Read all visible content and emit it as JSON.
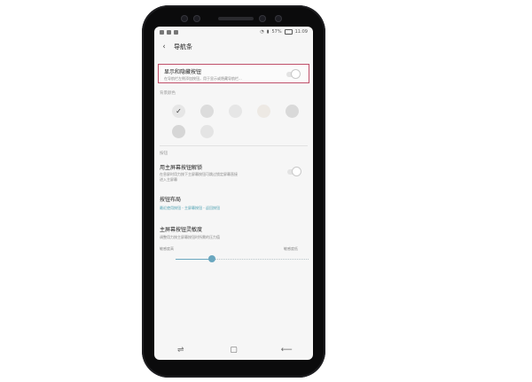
{
  "status": {
    "left_icons": [
      "whatsapp-icon",
      "mail-icon",
      "image-icon"
    ],
    "battery": "57%",
    "time": "11:09"
  },
  "header": {
    "title": "导航条"
  },
  "show_hide_buttons": {
    "title": "显示和隐藏按钮",
    "subtitle": "在导航栏左侧添加按钮，用于显示或隐藏导航栏...",
    "toggle_on": false
  },
  "background_color": {
    "label": "背景颜色",
    "swatches": [
      "#ffffff",
      "#e6e6e6",
      "#dcdcdc",
      "#e6e6e6",
      "#ede9e4",
      "#d9d9d9",
      "#d6d6d6",
      "#e4e4e4"
    ],
    "selected_index": 0
  },
  "buttons_section": {
    "label": "按钮"
  },
  "unlock_with_home": {
    "title": "用主屏幕按钮解锁",
    "subtitle_line1": "在息屏时用力按下主屏幕按钮可跳过锁定屏幕直接",
    "subtitle_line2": "进入主屏幕",
    "toggle_on": false
  },
  "button_layout": {
    "title": "按钮布局",
    "subtitle": "最近使用按钮 - 主屏幕按钮 - 返回按钮"
  },
  "home_sensitivity": {
    "title": "主屏幕按钮灵敏度",
    "subtitle": "调整用力按主屏幕按钮时所需的压力值",
    "min_label": "敏感度高",
    "max_label": "敏感度低",
    "value_fraction": 0.27
  },
  "navbar": {
    "recent_icon": "⇌",
    "home_icon": "▢",
    "back_icon": "⟵"
  },
  "icons": {
    "back": "‹"
  }
}
